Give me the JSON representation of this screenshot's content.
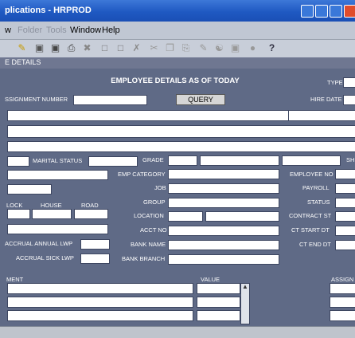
{
  "window": {
    "title": "plications - HRPROD"
  },
  "menu": {
    "items": [
      "w",
      "Folder",
      "Tools",
      "Window",
      "Help"
    ]
  },
  "toolbar": {
    "help_glyph": "?"
  },
  "panel": {
    "tab_label": "E DETAILS",
    "heading": "EMPLOYEE DETAILS AS OF TODAY"
  },
  "fields": {
    "assignment_number": "SSIGNMENT NUMBER",
    "query_button": "QUERY",
    "type": "TYPE",
    "hire_date": "HIRE DATE",
    "marital_status": "MARITAL STATUS",
    "grade": "GRADE",
    "sh": "SH",
    "emp_category": "EMP CATEGORY",
    "employee_no": "EMPLOYEE NO",
    "job": "JOB",
    "payroll": "PAYROLL",
    "group": "GROUP",
    "status": "STATUS",
    "lock": "LOCK",
    "house": "HOUSE",
    "road": "ROAD",
    "location": "LOCATION",
    "contract_st": "CONTRACT ST",
    "acct_no": "ACCT NO",
    "ct_start_dt": "CT START DT",
    "accrual_annual_lwp": "ACCRUAL ANNUAL LWP",
    "bank_name": "BANK NAME",
    "ct_end_dt": "CT END DT",
    "accrual_sick_lwp": "ACCRUAL SICK LWP",
    "bank_branch": "BANK BRANCH",
    "ment": "MENT",
    "value": "VALUE",
    "assign": "ASSIGN"
  },
  "colors": {
    "titlebar": "#1f59c2",
    "panel": "#5f6a86",
    "menubar": "#c0c7d3"
  }
}
